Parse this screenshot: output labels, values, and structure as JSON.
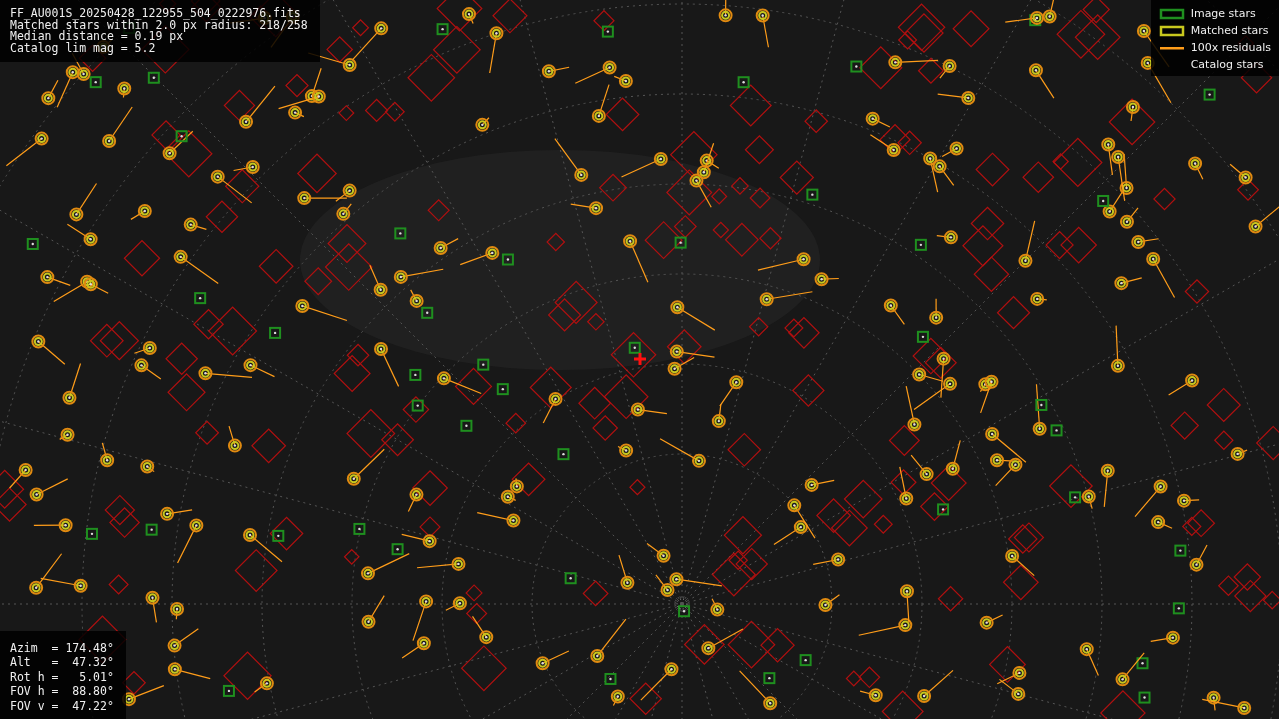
{
  "info": {
    "lines": [
      "FF_AU001S_20250428_122955_504_0222976.fits",
      "Matched stars within 2.0 px radius: 218/258",
      "Median distance = 0.19 px",
      "Catalog lim mag = 5.2"
    ]
  },
  "legend": [
    {
      "kind": "box",
      "label": "Image stars",
      "color": "#1f8f1f"
    },
    {
      "kind": "box",
      "label": "Matched stars",
      "color": "#c8c81e"
    },
    {
      "kind": "line",
      "label": "100x residuals",
      "color": "#ff9d1a"
    },
    {
      "kind": "none",
      "label": "Catalog stars"
    }
  ],
  "pointing": {
    "lines": [
      "Azim  = 174.48°",
      "Alt   =  47.32°",
      "Rot h =   5.01°",
      "FOV h =  88.80°",
      "FOV v =  47.22°"
    ]
  }
}
